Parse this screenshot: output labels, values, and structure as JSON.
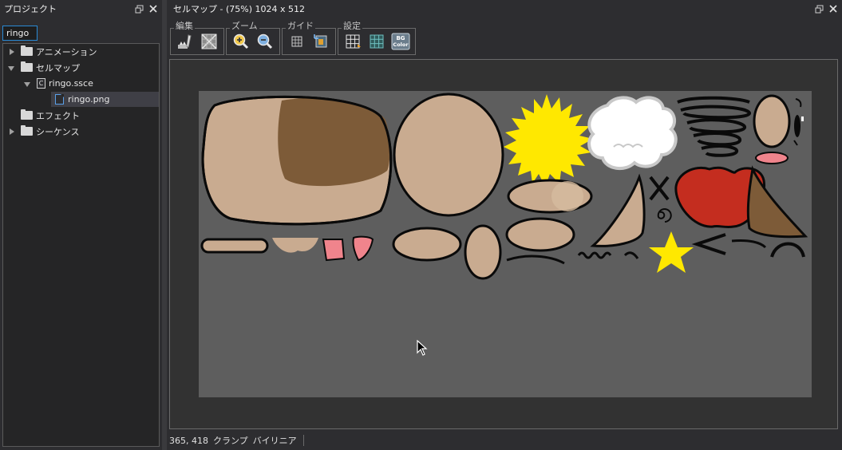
{
  "project_panel": {
    "title": "プロジェクト",
    "search_value": "ringo",
    "tree": [
      {
        "label": "アニメーション",
        "icon": "folder-icon",
        "expanded": false
      },
      {
        "label": "セルマップ",
        "icon": "folder-icon",
        "expanded": true
      },
      {
        "label": "ringo.ssce",
        "icon": "cellmap-file-icon",
        "expanded": true
      },
      {
        "label": "ringo.png",
        "icon": "image-file-icon",
        "selected": true
      },
      {
        "label": "エフェクト",
        "icon": "folder-icon"
      },
      {
        "label": "シーケンス",
        "icon": "folder-icon",
        "expanded": false
      }
    ]
  },
  "cellmap_panel": {
    "title": "セルマップ - (75%) 1024 x 512",
    "toolbar": {
      "edit_label": "編集",
      "zoom_label": "ズーム",
      "guide_label": "ガイド",
      "settings_label": "設定",
      "bg_color_label_top": "BG",
      "bg_color_label_bottom": "Color"
    },
    "status": {
      "coords": "365, 418",
      "wrap_mode": "クランプ",
      "filter_mode": "バイリニア"
    }
  },
  "colors": {
    "skin": "#c9ab90",
    "hair": "#7d5b38",
    "apple": "#c42d1f",
    "star": "#ffe800",
    "pink": "#f0848c",
    "outline": "#0a0a0a",
    "texture_bg": "#5e5e5e"
  }
}
